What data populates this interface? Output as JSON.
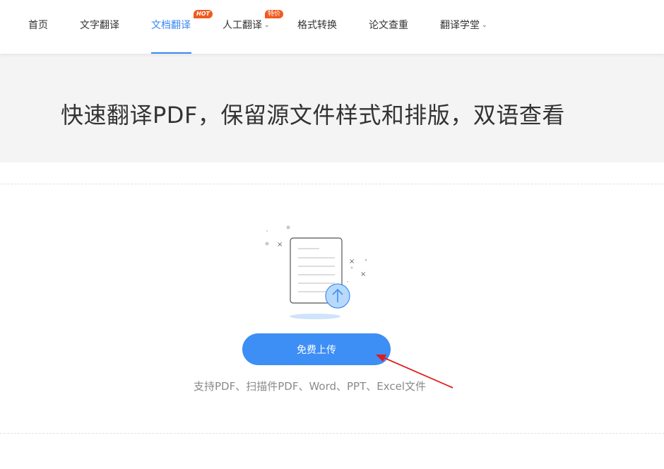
{
  "nav": {
    "items": [
      {
        "label": "首页"
      },
      {
        "label": "文字翻译"
      },
      {
        "label": "文档翻译",
        "badge": "HOT",
        "active": true
      },
      {
        "label": "人工翻译",
        "badge": "特价",
        "dropdown": true
      },
      {
        "label": "格式转换"
      },
      {
        "label": "论文查重"
      },
      {
        "label": "翻译学堂",
        "dropdown": true
      }
    ]
  },
  "hero": {
    "title": "快速翻译PDF，保留源文件样式和排版，双语查看"
  },
  "upload": {
    "button_label": "免费上传",
    "hint": "支持PDF、扫描件PDF、Word、PPT、Excel文件"
  },
  "colors": {
    "accent": "#3a86f5",
    "button": "#3d8ef5",
    "badge": "#f05a1e",
    "annotation_arrow": "#e01b1b"
  }
}
